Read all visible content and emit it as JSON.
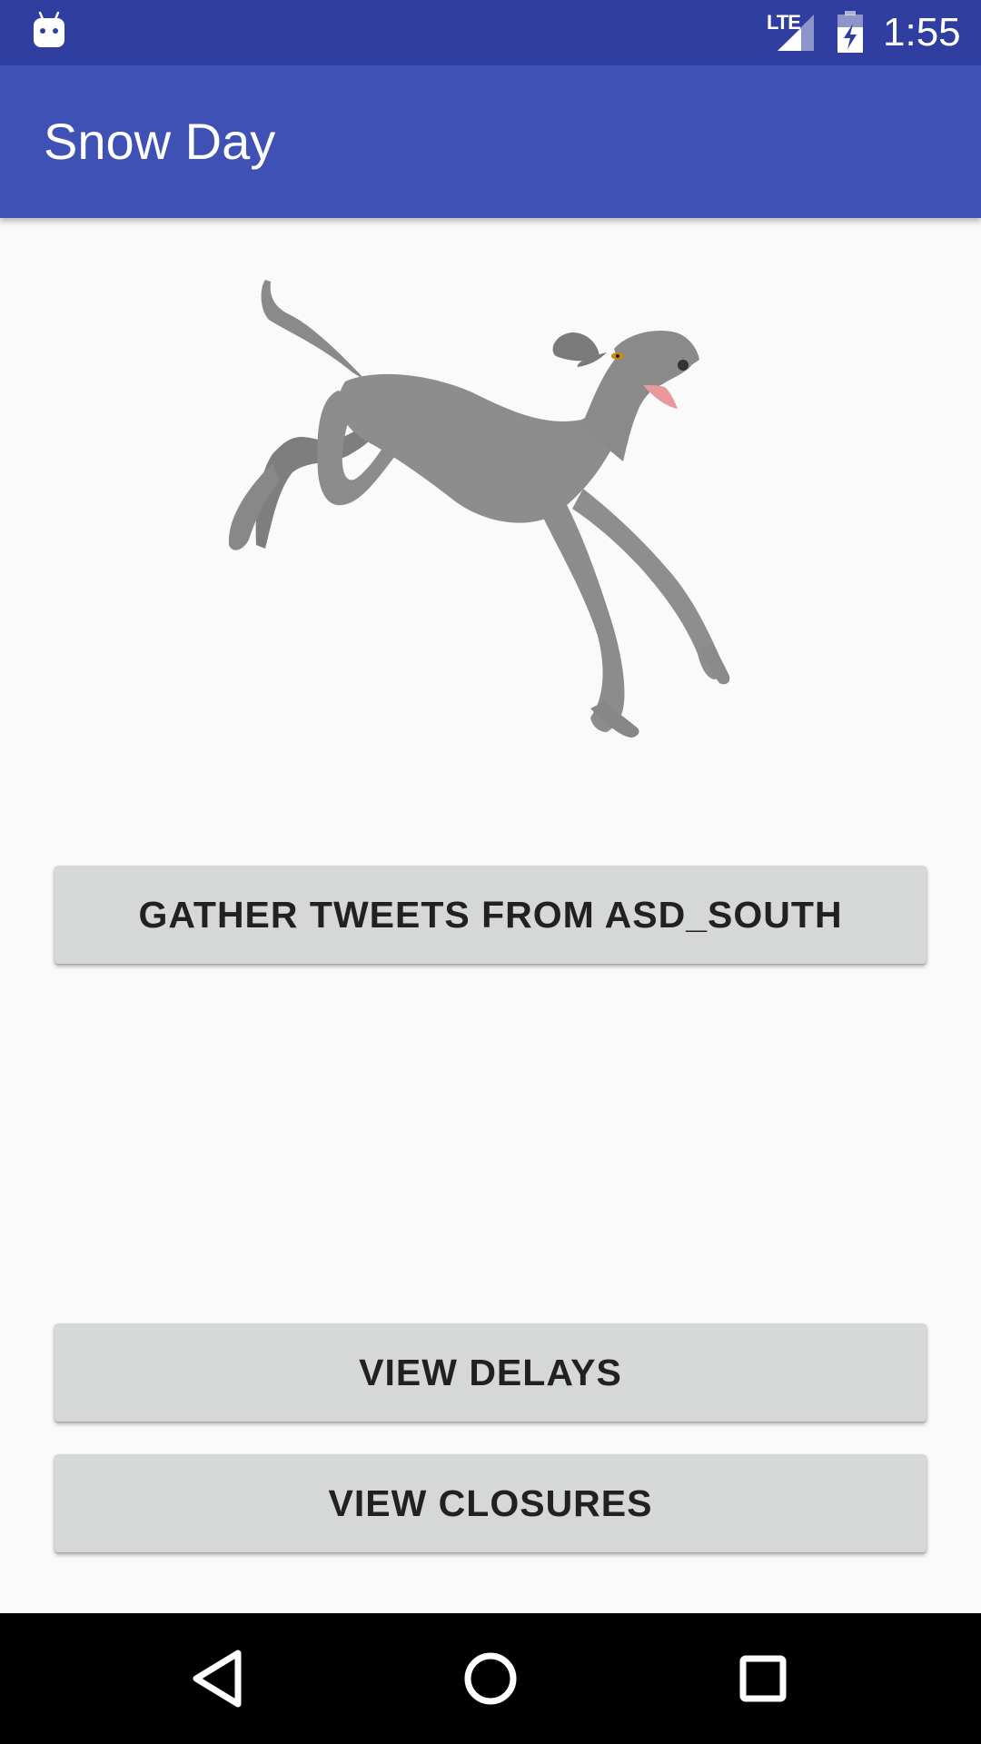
{
  "status_bar": {
    "network": "LTE",
    "time": "1:55",
    "icons": [
      "android-debug-icon",
      "signal-icon",
      "battery-charging-icon"
    ]
  },
  "app_bar": {
    "title": "Snow Day"
  },
  "illustration": {
    "icon": "running-greyhound-image"
  },
  "buttons": {
    "gather": "GATHER TWEETS FROM ASD_SOUTH",
    "delays": "VIEW DELAYS",
    "closures": "VIEW CLOSURES"
  },
  "nav_bar": {
    "icons": [
      "back-icon",
      "home-icon",
      "recents-icon"
    ]
  },
  "colors": {
    "status_bar": "#303f9f",
    "app_bar": "#3f51b5",
    "background": "#fafafa",
    "button": "#d6d7d7",
    "button_text": "#212121"
  }
}
